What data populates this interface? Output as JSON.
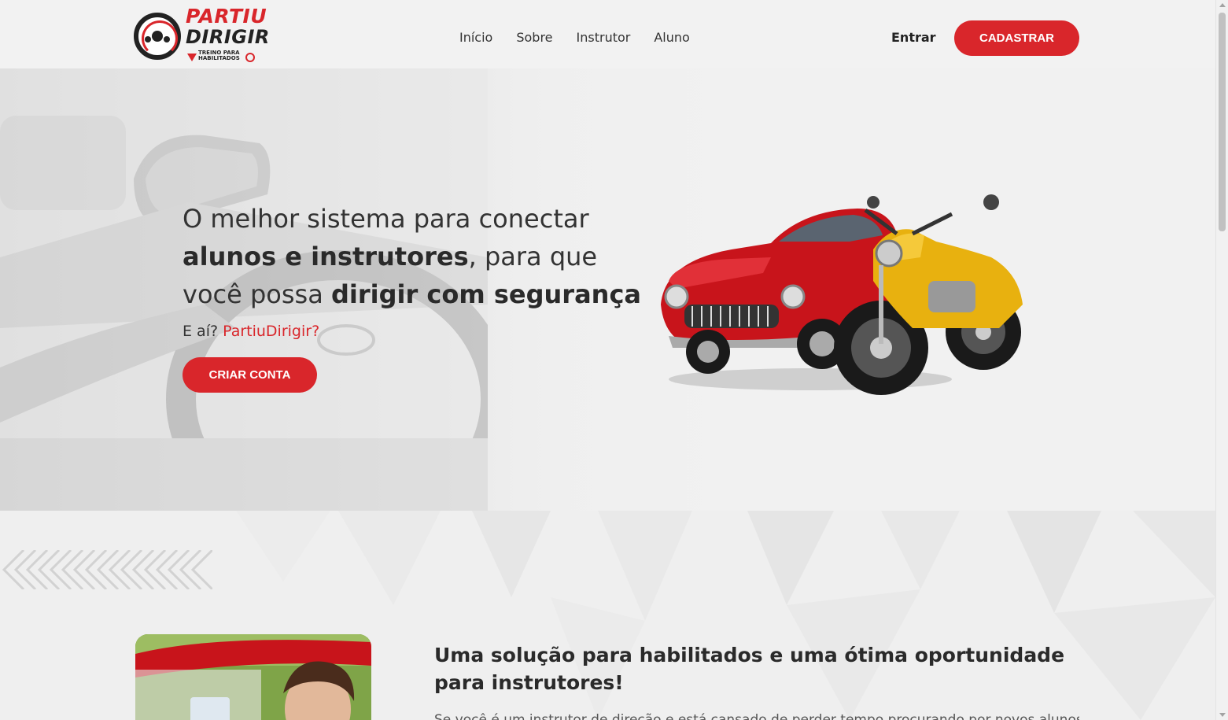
{
  "header": {
    "logo": {
      "line1": "PARTIU",
      "line2": "DIRIGIR",
      "tagline": "TREINO PARA HABILITADOS"
    },
    "nav": [
      "Início",
      "Sobre",
      "Instrutor",
      "Aluno"
    ],
    "login_label": "Entrar",
    "signup_label": "CADASTRAR"
  },
  "hero": {
    "title_part1": "O melhor sistema para conectar ",
    "title_bold1": "alunos e instrutores",
    "title_part2": ", para que você possa ",
    "title_bold2": "dirigir com segurança",
    "subtitle_prefix": "E aí? ",
    "subtitle_brand": "PartiuDirigir?",
    "cta_label": "CRIAR CONTA"
  },
  "section2": {
    "title": "Uma solução para habilitados e uma ótima oportunidade para instrutores!",
    "text": "Se você é um instrutor de direção e está cansado de perder tempo procurando por novos alunos e"
  },
  "colors": {
    "accent": "#d9262b",
    "text": "#333333",
    "background": "#f1f1f1"
  }
}
